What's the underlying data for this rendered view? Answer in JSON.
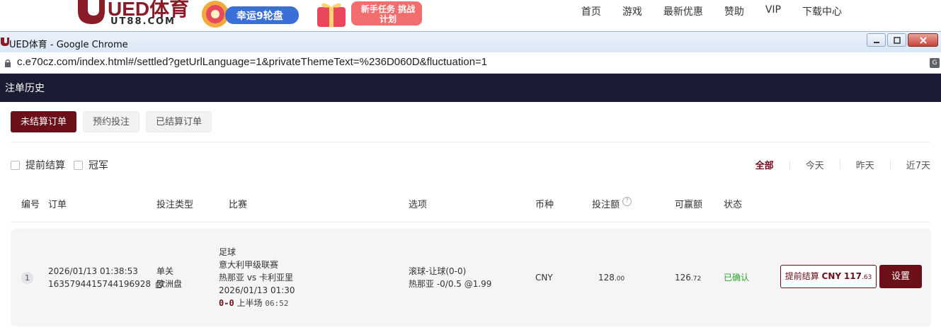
{
  "site": {
    "logo_text": "UED体育",
    "logo_sub": "UT88.COM",
    "promo1_label": "幸运9轮盘",
    "promo2_label": "新手任务 挑战计划",
    "nav": [
      "首页",
      "游戏",
      "最新优惠",
      "赞助",
      "VIP",
      "下载中心"
    ]
  },
  "window": {
    "title": "UED体育 - Google Chrome"
  },
  "address": {
    "url": "c.e70cz.com/index.html#/settled?getUrlLanguage=1&privateThemeText=%236D060D&fluctuation=1"
  },
  "page": {
    "title": "注单历史"
  },
  "tabs": [
    {
      "label": "未结算订单",
      "active": true
    },
    {
      "label": "预约投注",
      "active": false
    },
    {
      "label": "已结算订单",
      "active": false
    }
  ],
  "filters": {
    "early_cashout": "提前结算",
    "champion": "冠军"
  },
  "range": [
    {
      "label": "全部",
      "active": true
    },
    {
      "label": "今天",
      "active": false
    },
    {
      "label": "昨天",
      "active": false
    },
    {
      "label": "近7天",
      "active": false
    }
  ],
  "table": {
    "headers": {
      "no": "编号",
      "order": "订单",
      "bet_type": "投注类型",
      "match": "比赛",
      "selection": "选项",
      "currency": "币种",
      "stake": "投注额",
      "payout": "可赢额",
      "status": "状态"
    },
    "row": {
      "index": "1",
      "datetime": "2026/01/13 01:38:53",
      "order_id": "1635794415744196928",
      "bet_type": "单关",
      "odds_type": "欧洲盘",
      "sport": "足球",
      "league": "意大利甲级联赛",
      "teams": "热那亚 vs 卡利亚里",
      "match_time": "2026/01/13 01:30",
      "score": "0-0",
      "period": "上半场",
      "clock": "06:52",
      "selection_market": "滚球-让球(0-0)",
      "selection_detail": "热那亚 -0/0.5 @1.99",
      "currency": "CNY",
      "stake_int": "128",
      "stake_dec": ".00",
      "payout_int": "126",
      "payout_dec": ".72",
      "status": "已确认",
      "cashout_label": "提前结算",
      "cashout_currency": "CNY",
      "cashout_int": "117",
      "cashout_dec": ".63",
      "settings_label": "设置"
    }
  },
  "colors": {
    "brand": "#6b0f19",
    "header_bg": "#1c1b34",
    "status_ok": "#2aa52a"
  }
}
